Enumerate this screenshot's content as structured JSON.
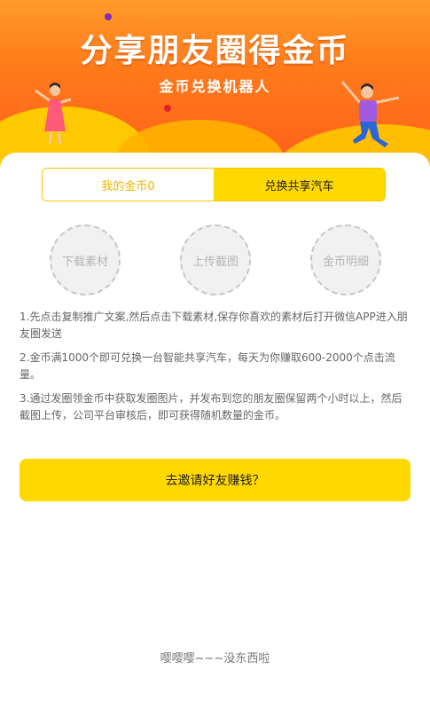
{
  "banner": {
    "title": "分享朋友圈得金币",
    "subtitle": "金币兑换机器人"
  },
  "tabs": [
    {
      "label": "我的金币0",
      "active": false
    },
    {
      "label": "兑换共享汽车",
      "active": true
    }
  ],
  "actions": [
    {
      "label": "下载素材"
    },
    {
      "label": "上传截图"
    },
    {
      "label": "金币明细"
    }
  ],
  "instructions": [
    "1.先点击复制推广文案,然后点击下载素材,保存你喜欢的素材后打开微信APP进入朋友圈发送",
    "2.金币满1000个即可兑换一台智能共享汽车，每天为你赚取600-2000个点击流量。",
    "3.通过发圈领金币中获取发圈图片，并发布到您的朋友圈保留两个小时以上，然后截图上传，公司平台审核后，即可获得随机数量的金币。"
  ],
  "invite_button": {
    "label": "去邀请好友赚钱？"
  },
  "footer": {
    "text": "嘤嘤嘤~~~没东西啦"
  },
  "colors": {
    "accent_yellow": "#ffd800",
    "banner_orange": "#ff7a1a",
    "tab_inactive_text": "#e8b800"
  }
}
